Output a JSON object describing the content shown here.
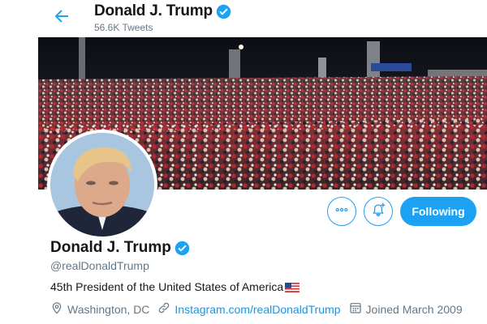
{
  "header": {
    "name": "Donald J. Trump",
    "tweet_count": "56.6K Tweets"
  },
  "profile": {
    "name": "Donald J. Trump",
    "handle": "@realDonaldTrump",
    "bio": "45th President of the United States of America",
    "location": "Washington, DC",
    "website": "Instagram.com/realDonaldTrump",
    "joined": "Joined March 2009"
  },
  "actions": {
    "more_icon": "more-dots-icon",
    "notify_icon": "add-notification-icon",
    "follow_label": "Following"
  },
  "colors": {
    "accent": "#1da1f2",
    "secondary_text": "#657786",
    "link": "#1b95e0"
  }
}
